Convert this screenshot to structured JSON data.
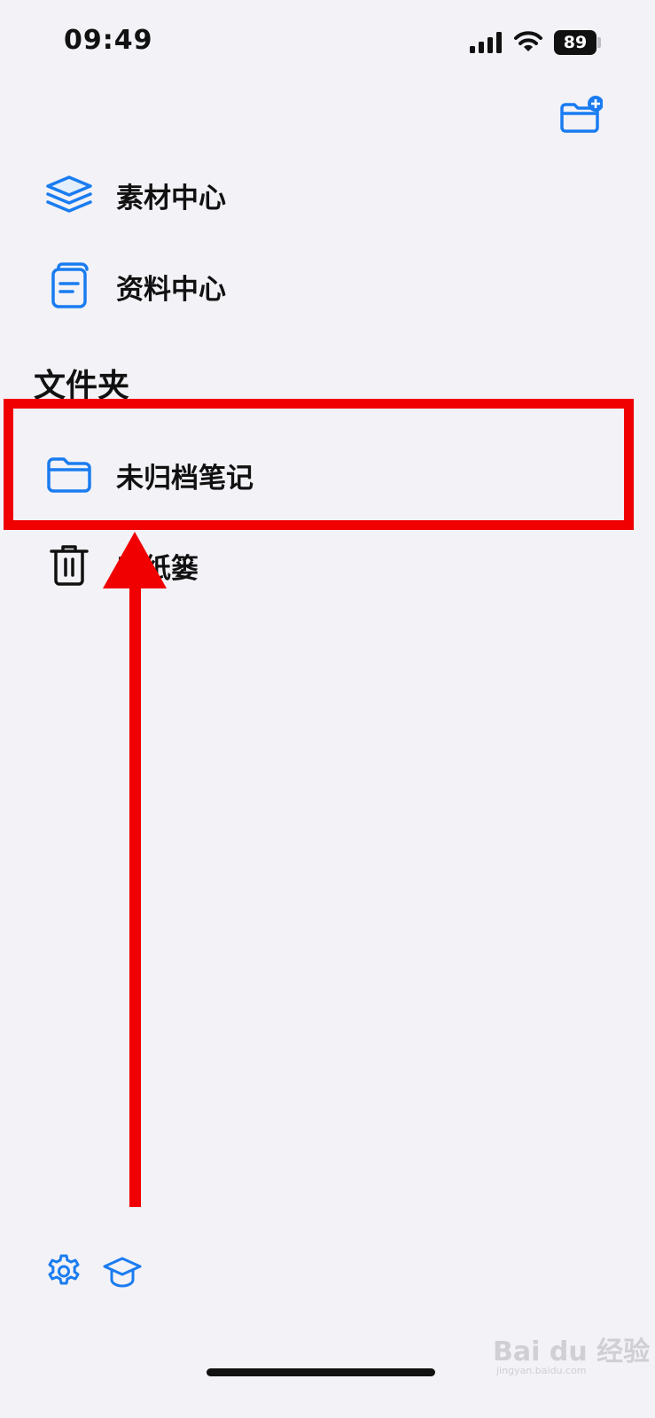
{
  "status_bar": {
    "time": "09:49",
    "battery": "89"
  },
  "menu": {
    "items": [
      {
        "label": "素材中心",
        "icon": "layers-icon"
      },
      {
        "label": "资料中心",
        "icon": "document-icon"
      }
    ]
  },
  "folders": {
    "section_title": "文件夹",
    "items": [
      {
        "label": "未归档笔记",
        "icon": "folder-icon"
      },
      {
        "label": "废纸篓",
        "icon": "trash-icon"
      }
    ]
  },
  "bottom_bar": {
    "icons": [
      "gear-icon",
      "graduation-cap-icon"
    ]
  },
  "watermark": {
    "text": "Bai du 经验",
    "sub": "jingyan.baidu.com"
  },
  "colors": {
    "accent": "#1a7cf0",
    "annotation": "#f00000",
    "background": "#f2f2f7"
  }
}
